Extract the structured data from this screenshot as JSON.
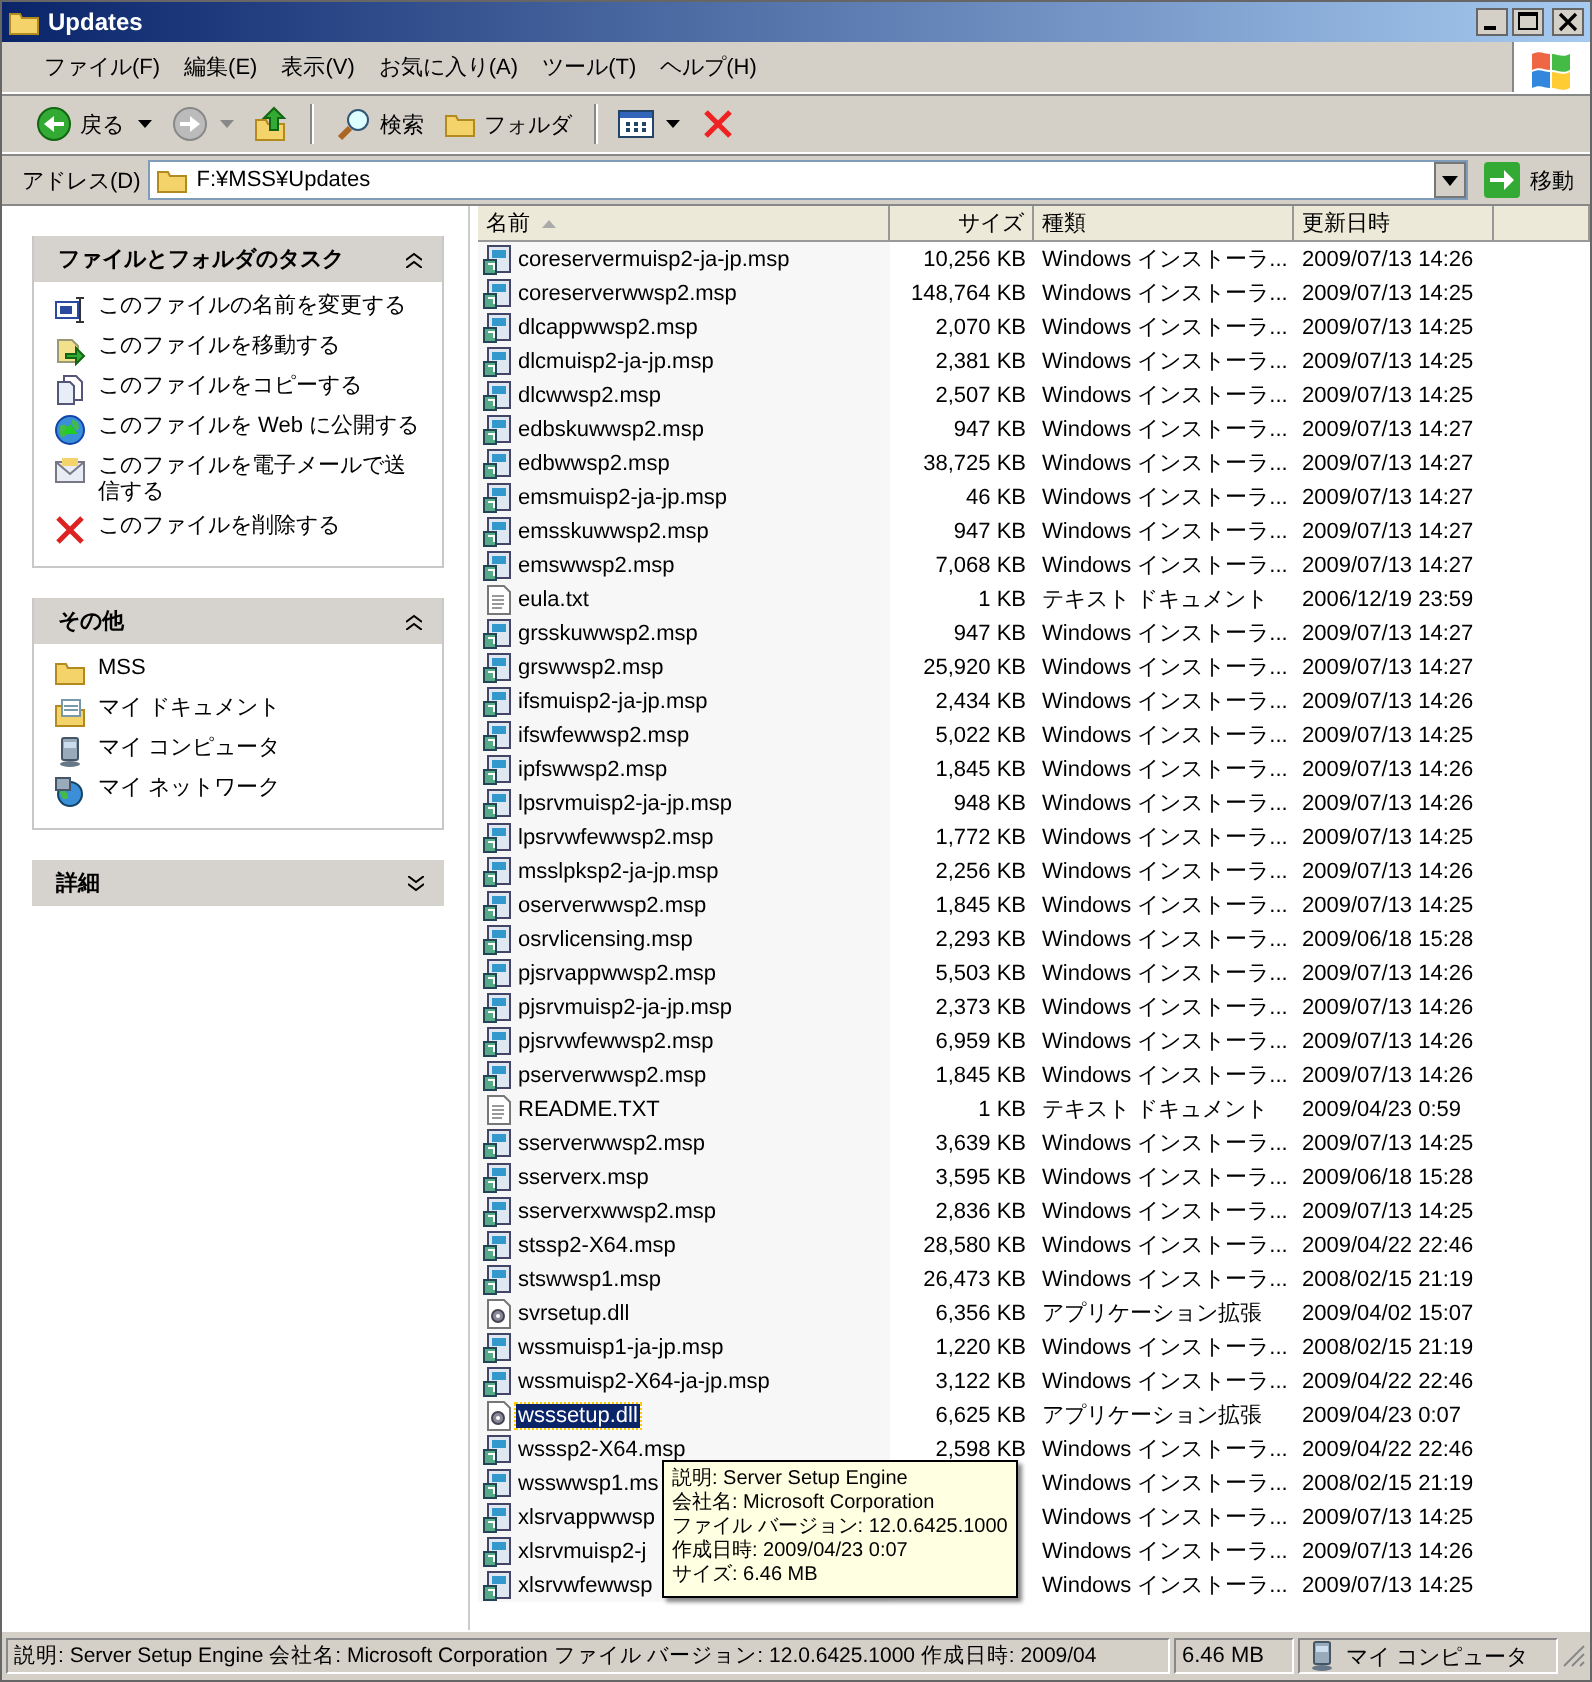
{
  "window": {
    "title": "Updates"
  },
  "menu": [
    "ファイル(F)",
    "編集(E)",
    "表示(V)",
    "お気に入り(A)",
    "ツール(T)",
    "ヘルプ(H)"
  ],
  "toolbar": {
    "back": "戻る",
    "search": "検索",
    "folders": "フォルダ"
  },
  "address": {
    "label": "アドレス(D)",
    "value": "F:¥MSS¥Updates",
    "go": "移動"
  },
  "sidebar": [
    {
      "title": "ファイルとフォルダのタスク",
      "expanded": true,
      "items": [
        {
          "label": "このファイルの名前を変更する",
          "kind": "rename"
        },
        {
          "label": "このファイルを移動する",
          "kind": "move"
        },
        {
          "label": "このファイルをコピーする",
          "kind": "copy"
        },
        {
          "label": "このファイルを Web に公開する",
          "kind": "web"
        },
        {
          "label": "このファイルを電子メールで送信する",
          "kind": "mail"
        },
        {
          "label": "このファイルを削除する",
          "kind": "delete"
        }
      ]
    },
    {
      "title": "その他",
      "expanded": true,
      "items": [
        {
          "label": "MSS",
          "kind": "folder"
        },
        {
          "label": "マイ ドキュメント",
          "kind": "documents"
        },
        {
          "label": "マイ コンピュータ",
          "kind": "computer"
        },
        {
          "label": "マイ ネットワーク",
          "kind": "network"
        }
      ]
    },
    {
      "title": "詳細",
      "expanded": false
    }
  ],
  "table": {
    "columns": [
      "名前",
      "サイズ",
      "種類",
      "更新日時"
    ],
    "rows": [
      {
        "name": "coreservermuisp2-ja-jp.msp",
        "size": "10,256 KB",
        "type": "Windows インストーラ...",
        "date": "2009/07/13 14:26",
        "kind": "msp",
        "selected": false
      },
      {
        "name": "coreserverwwsp2.msp",
        "size": "148,764 KB",
        "type": "Windows インストーラ...",
        "date": "2009/07/13 14:25",
        "kind": "msp",
        "selected": false
      },
      {
        "name": "dlcappwwsp2.msp",
        "size": "2,070 KB",
        "type": "Windows インストーラ...",
        "date": "2009/07/13 14:25",
        "kind": "msp",
        "selected": false
      },
      {
        "name": "dlcmuisp2-ja-jp.msp",
        "size": "2,381 KB",
        "type": "Windows インストーラ...",
        "date": "2009/07/13 14:25",
        "kind": "msp",
        "selected": false
      },
      {
        "name": "dlcwwsp2.msp",
        "size": "2,507 KB",
        "type": "Windows インストーラ...",
        "date": "2009/07/13 14:25",
        "kind": "msp",
        "selected": false
      },
      {
        "name": "edbskuwwsp2.msp",
        "size": "947 KB",
        "type": "Windows インストーラ...",
        "date": "2009/07/13 14:27",
        "kind": "msp",
        "selected": false
      },
      {
        "name": "edbwwsp2.msp",
        "size": "38,725 KB",
        "type": "Windows インストーラ...",
        "date": "2009/07/13 14:27",
        "kind": "msp",
        "selected": false
      },
      {
        "name": "emsmuisp2-ja-jp.msp",
        "size": "46 KB",
        "type": "Windows インストーラ...",
        "date": "2009/07/13 14:27",
        "kind": "msp",
        "selected": false
      },
      {
        "name": "emsskuwwsp2.msp",
        "size": "947 KB",
        "type": "Windows インストーラ...",
        "date": "2009/07/13 14:27",
        "kind": "msp",
        "selected": false
      },
      {
        "name": "emswwsp2.msp",
        "size": "7,068 KB",
        "type": "Windows インストーラ...",
        "date": "2009/07/13 14:27",
        "kind": "msp",
        "selected": false
      },
      {
        "name": "eula.txt",
        "size": "1 KB",
        "type": "テキスト ドキュメント",
        "date": "2006/12/19 23:59",
        "kind": "txt",
        "selected": false
      },
      {
        "name": "grsskuwwsp2.msp",
        "size": "947 KB",
        "type": "Windows インストーラ...",
        "date": "2009/07/13 14:27",
        "kind": "msp",
        "selected": false
      },
      {
        "name": "grswwsp2.msp",
        "size": "25,920 KB",
        "type": "Windows インストーラ...",
        "date": "2009/07/13 14:27",
        "kind": "msp",
        "selected": false
      },
      {
        "name": "ifsmuisp2-ja-jp.msp",
        "size": "2,434 KB",
        "type": "Windows インストーラ...",
        "date": "2009/07/13 14:26",
        "kind": "msp",
        "selected": false
      },
      {
        "name": "ifswfewwsp2.msp",
        "size": "5,022 KB",
        "type": "Windows インストーラ...",
        "date": "2009/07/13 14:25",
        "kind": "msp",
        "selected": false
      },
      {
        "name": "ipfswwsp2.msp",
        "size": "1,845 KB",
        "type": "Windows インストーラ...",
        "date": "2009/07/13 14:26",
        "kind": "msp",
        "selected": false
      },
      {
        "name": "lpsrvmuisp2-ja-jp.msp",
        "size": "948 KB",
        "type": "Windows インストーラ...",
        "date": "2009/07/13 14:26",
        "kind": "msp",
        "selected": false
      },
      {
        "name": "lpsrvwfewwsp2.msp",
        "size": "1,772 KB",
        "type": "Windows インストーラ...",
        "date": "2009/07/13 14:25",
        "kind": "msp",
        "selected": false
      },
      {
        "name": "msslpksp2-ja-jp.msp",
        "size": "2,256 KB",
        "type": "Windows インストーラ...",
        "date": "2009/07/13 14:26",
        "kind": "msp",
        "selected": false
      },
      {
        "name": "oserverwwsp2.msp",
        "size": "1,845 KB",
        "type": "Windows インストーラ...",
        "date": "2009/07/13 14:25",
        "kind": "msp",
        "selected": false
      },
      {
        "name": "osrvlicensing.msp",
        "size": "2,293 KB",
        "type": "Windows インストーラ...",
        "date": "2009/06/18 15:28",
        "kind": "msp",
        "selected": false
      },
      {
        "name": "pjsrvappwwsp2.msp",
        "size": "5,503 KB",
        "type": "Windows インストーラ...",
        "date": "2009/07/13 14:26",
        "kind": "msp",
        "selected": false
      },
      {
        "name": "pjsrvmuisp2-ja-jp.msp",
        "size": "2,373 KB",
        "type": "Windows インストーラ...",
        "date": "2009/07/13 14:26",
        "kind": "msp",
        "selected": false
      },
      {
        "name": "pjsrvwfewwsp2.msp",
        "size": "6,959 KB",
        "type": "Windows インストーラ...",
        "date": "2009/07/13 14:26",
        "kind": "msp",
        "selected": false
      },
      {
        "name": "pserverwwsp2.msp",
        "size": "1,845 KB",
        "type": "Windows インストーラ...",
        "date": "2009/07/13 14:26",
        "kind": "msp",
        "selected": false
      },
      {
        "name": "README.TXT",
        "size": "1 KB",
        "type": "テキスト ドキュメント",
        "date": "2009/04/23 0:59",
        "kind": "txt",
        "selected": false
      },
      {
        "name": "sserverwwsp2.msp",
        "size": "3,639 KB",
        "type": "Windows インストーラ...",
        "date": "2009/07/13 14:25",
        "kind": "msp",
        "selected": false
      },
      {
        "name": "sserverx.msp",
        "size": "3,595 KB",
        "type": "Windows インストーラ...",
        "date": "2009/06/18 15:28",
        "kind": "msp",
        "selected": false
      },
      {
        "name": "sserverxwwsp2.msp",
        "size": "2,836 KB",
        "type": "Windows インストーラ...",
        "date": "2009/07/13 14:25",
        "kind": "msp",
        "selected": false
      },
      {
        "name": "stssp2-X64.msp",
        "size": "28,580 KB",
        "type": "Windows インストーラ...",
        "date": "2009/04/22 22:46",
        "kind": "msp",
        "selected": false
      },
      {
        "name": "stswwsp1.msp",
        "size": "26,473 KB",
        "type": "Windows インストーラ...",
        "date": "2008/02/15 21:19",
        "kind": "msp",
        "selected": false
      },
      {
        "name": "svrsetup.dll",
        "size": "6,356 KB",
        "type": "アプリケーション拡張",
        "date": "2009/04/02 15:07",
        "kind": "dll",
        "selected": false
      },
      {
        "name": "wssmuisp1-ja-jp.msp",
        "size": "1,220 KB",
        "type": "Windows インストーラ...",
        "date": "2008/02/15 21:19",
        "kind": "msp",
        "selected": false
      },
      {
        "name": "wssmuisp2-X64-ja-jp.msp",
        "size": "3,122 KB",
        "type": "Windows インストーラ...",
        "date": "2009/04/22 22:46",
        "kind": "msp",
        "selected": false
      },
      {
        "name": "wsssetup.dll",
        "size": "6,625 KB",
        "type": "アプリケーション拡張",
        "date": "2009/04/23 0:07",
        "kind": "dll",
        "selected": true
      },
      {
        "name": "wsssp2-X64.msp",
        "size": "2,598 KB",
        "type": "Windows インストーラ...",
        "date": "2009/04/22 22:46",
        "kind": "msp",
        "selected": false
      },
      {
        "name": "wsswwsp1.ms",
        "type": "Windows インストーラ...",
        "date": "2008/02/15 21:19",
        "kind": "msp",
        "selected": false
      },
      {
        "name": "xlsrvappwwsp",
        "type": "Windows インストーラ...",
        "date": "2009/07/13 14:25",
        "kind": "msp",
        "selected": false
      },
      {
        "name": "xlsrvmuisp2-j",
        "type": "Windows インストーラ...",
        "date": "2009/07/13 14:26",
        "kind": "msp",
        "selected": false
      },
      {
        "name": "xlsrvwfewwsp",
        "type": "Windows インストーラ...",
        "date": "2009/07/13 14:25",
        "kind": "msp",
        "selected": false
      }
    ]
  },
  "tooltip": [
    "説明: Server Setup Engine",
    "会社名: Microsoft Corporation",
    "ファイル バージョン: 12.0.6425.1000",
    "作成日時: 2009/04/23 0:07",
    "サイズ: 6.46 MB"
  ],
  "status_bar": {
    "description": "説明: Server Setup Engine 会社名: Microsoft Corporation ファイル バージョン: 12.0.6425.1000 作成日時: 2009/04",
    "size": "6.46 MB",
    "zone": "マイ コンピュータ"
  }
}
